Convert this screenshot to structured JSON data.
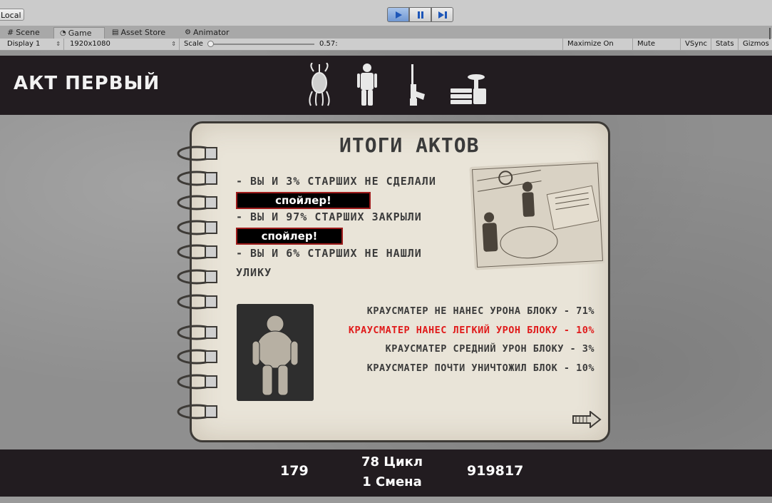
{
  "editor": {
    "local_label": "Local",
    "tabs": [
      {
        "label": "Scene",
        "icon": "grid-icon"
      },
      {
        "label": "Game",
        "icon": "pacman-icon"
      },
      {
        "label": "Asset Store",
        "icon": "store-icon"
      },
      {
        "label": "Animator",
        "icon": "animator-icon"
      }
    ],
    "toolbar": {
      "display": "Display 1",
      "resolution": "1920x1080",
      "scale_label": "Scale",
      "scale_value": "0.57:",
      "maximize": "Maximize On Play",
      "mute": "Mute Audio",
      "vsync": "VSync",
      "stats": "Stats",
      "gizmos": "Gizmos"
    }
  },
  "game": {
    "act_title": "АКТ ПЕРВЫЙ",
    "header_icons": [
      "monster-icon",
      "person-icon",
      "rifle-icon",
      "scale-icon"
    ],
    "notebook": {
      "title": "ИТОГИ АКТОВ",
      "lines": [
        "- ВЫ И 3% СТАРШИХ НЕ СДЕЛАЛИ",
        "- ВЫ И 97% СТАРШИХ ЗАКРЫЛИ",
        "- ВЫ И 6% СТАРШИХ НЕ НАШЛИ",
        "УЛИКУ"
      ],
      "spoiler_1": "спойлер!",
      "spoiler_2": "спойлер!",
      "stats": [
        "КРАУСМАТЕР НЕ НАНЕС УРОНА БЛОКУ - 71%",
        "КРАУСМАТЕР НАНЕС ЛЕГКИЙ УРОН БЛОКУ - 10%",
        "КРАУСМАТЕР СРЕДНИЙ УРОН БЛОКУ - 3%",
        "КРАУСМАТЕР ПОЧТИ УНИЧТОЖИЛ БЛОК - 10%"
      ],
      "highlight_color": "#e01b1b"
    },
    "footer": {
      "left": "179",
      "cycle": "78 Цикл",
      "shift": "1 Смена",
      "right": "919817"
    }
  }
}
